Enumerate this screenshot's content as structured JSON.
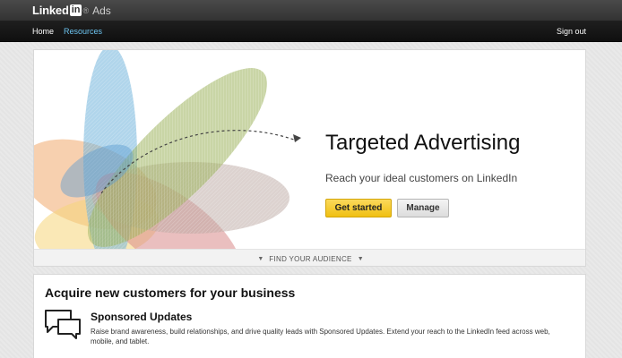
{
  "header": {
    "logo_word": "Linked",
    "logo_in": "in",
    "logo_dot": "®",
    "product": "Ads"
  },
  "nav": {
    "home": "Home",
    "resources": "Resources",
    "sign_out": "Sign out"
  },
  "hero": {
    "title": "Targeted Advertising",
    "subtitle": "Reach your ideal customers on LinkedIn",
    "primary_button": "Get started",
    "secondary_button": "Manage",
    "footer_link": "FIND YOUR AUDIENCE"
  },
  "section": {
    "title": "Acquire new customers for your business",
    "items": [
      {
        "icon": "chat-bubbles-icon",
        "title": "Sponsored Updates",
        "description": "Raise brand awareness, build relationships, and drive quality leads with Sponsored Updates. Extend your reach to the LinkedIn feed across web, mobile, and tablet."
      }
    ]
  },
  "colors": {
    "topbar": "#3d3d3d",
    "navbar": "#161616",
    "resources_link": "#6cc3ef",
    "primary_button": "#f5c82b",
    "page_background": "#e9e9e9"
  }
}
